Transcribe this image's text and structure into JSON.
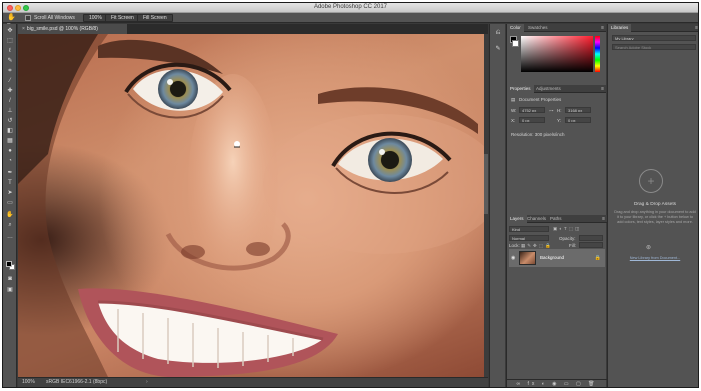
{
  "window": {
    "title": "Adobe Photoshop CC 2017"
  },
  "options_bar": {
    "tool_icon": "hand-icon",
    "scroll_all_windows_label": "Scroll All Windows",
    "zoom_100_label": "100%",
    "fit_screen_label": "Fit Screen",
    "fill_screen_label": "Fill Screen"
  },
  "document": {
    "tab_label": "big_smile.psd @ 100% (RGB/8)",
    "status_zoom": "100%",
    "status_profile": "sRGB IEC61966-2.1 (8bpc)"
  },
  "color_panel": {
    "tabs": [
      "Color",
      "Swatches"
    ]
  },
  "properties_panel": {
    "tabs": [
      "Properties",
      "Adjustments"
    ],
    "section_title": "Document Properties",
    "w_label": "W:",
    "w_value": "4752 px",
    "h_label": "H:",
    "h_value": "3168 px",
    "x_label": "X:",
    "x_value": "0 px",
    "y_label": "Y:",
    "y_value": "0 px",
    "resolution": "Resolution: 300 pixels/inch"
  },
  "layers_panel": {
    "tabs": [
      "Layers",
      "Channels",
      "Paths"
    ],
    "kind_label": "Kind",
    "blend_mode": "Normal",
    "opacity_label": "Opacity:",
    "lock_label": "Lock:",
    "fill_label": "Fill:",
    "layer_name": "Background",
    "footer_icons": "∞ fx ◐ ◉ ▭ ▢ 🗑"
  },
  "libraries_panel": {
    "tab": "Libraries",
    "library_select": "My Library",
    "search_placeholder": "Search Adobe Stock",
    "drag_title": "Drag & Drop Assets",
    "drag_text": "Drag and drop anything in your document to add it to your library, or click the + button below to add colors, text styles, layer styles and more.",
    "new_library": "New Library from Document..."
  },
  "colors": {
    "accent": "#2d8ceb",
    "panel": "#535353",
    "dark": "#3a3a3a"
  }
}
